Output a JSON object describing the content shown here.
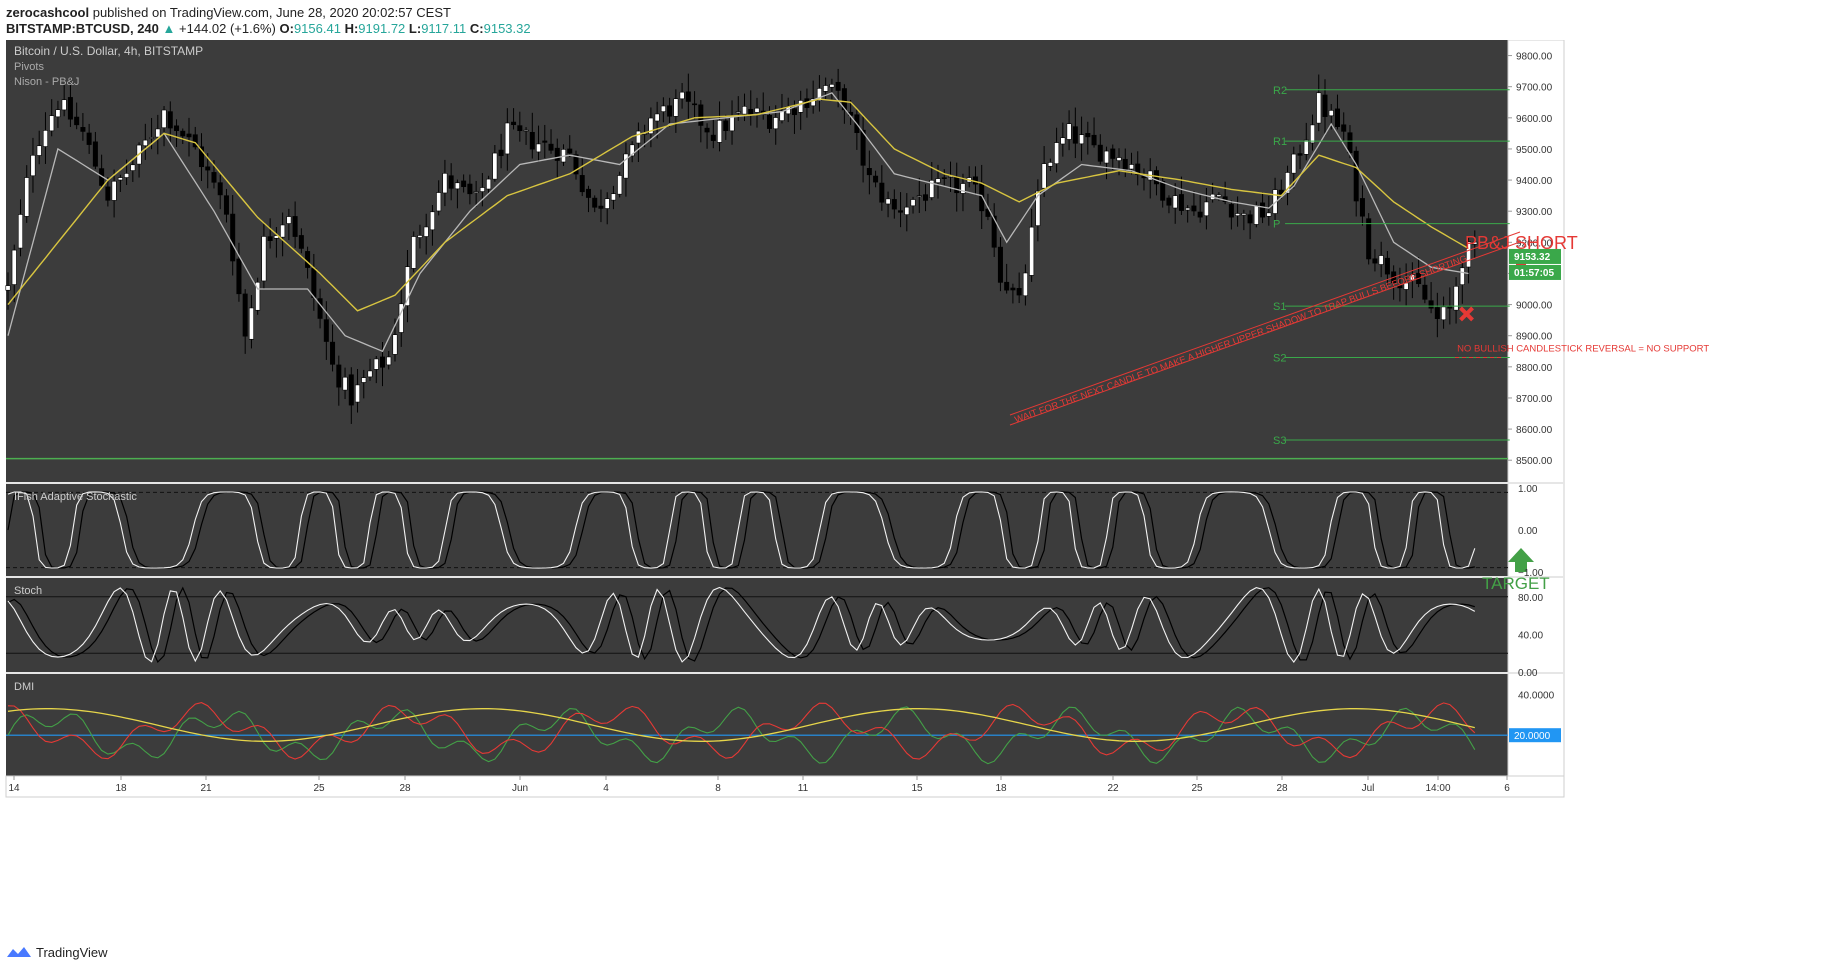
{
  "header": {
    "author": "zerocashcool",
    "published": "published on TradingView.com, June 28, 2020 20:02:57 CEST",
    "symbol": "BITSTAMP:BTCUSD, 240",
    "change": "+144.02 (+1.6%)",
    "o_label": "O:",
    "o": "9156.41",
    "h_label": "H:",
    "h": "9191.72",
    "l_label": "L:",
    "l": "9117.11",
    "c_label": "C:",
    "c": "9153.32"
  },
  "footer": {
    "brand": "TradingView"
  },
  "colors": {
    "panel_bg": "#3c3c3c",
    "ema_slow": "#d8c540",
    "ema_fast": "#b8b8b8",
    "pivot": "#3aa84a",
    "annotation_red": "#e53935",
    "target_green": "#43a047",
    "dmi_plus": "#43a047",
    "dmi_minus": "#e53935",
    "adx": "#e6d54a",
    "dmi_threshold": "#2196f3",
    "price_tag": "#3aa84a"
  },
  "chart_data": [
    {
      "type": "candlestick",
      "title": "Bitcoin / U.S. Dollar, 4h, BITSTAMP",
      "indicators": [
        "Pivots",
        "Nison - PB&J"
      ],
      "ylim": [
        8430,
        9850
      ],
      "y_ticks": [
        9800,
        9700,
        9600,
        9500,
        9400,
        9300,
        9200,
        9100,
        9000,
        8900,
        8800,
        8700,
        8600,
        8500
      ],
      "y_tick_labels": [
        "9800.00",
        "9700.00",
        "9600.00",
        "9500.00",
        "9400.00",
        "9300.00",
        "9200.00",
        "9100.00",
        "9000.00",
        "8900.00",
        "8800.00",
        "8700.00",
        "8600.00",
        "8500.00"
      ],
      "x_ticks": [
        "14",
        "18",
        "21",
        "25",
        "28",
        "Jun",
        "4",
        "8",
        "11",
        "15",
        "18",
        "22",
        "25",
        "28",
        "Jul",
        "14:00",
        "6"
      ],
      "close_path": [
        [
          0,
          9050
        ],
        [
          4,
          9500
        ],
        [
          8,
          9650
        ],
        [
          12,
          9550
        ],
        [
          16,
          9350
        ],
        [
          20,
          9450
        ],
        [
          25,
          9620
        ],
        [
          30,
          9500
        ],
        [
          35,
          9300
        ],
        [
          38,
          8900
        ],
        [
          41,
          9200
        ],
        [
          45,
          9300
        ],
        [
          48,
          9100
        ],
        [
          52,
          8800
        ],
        [
          55,
          8700
        ],
        [
          58,
          8780
        ],
        [
          61,
          8830
        ],
        [
          65,
          9200
        ],
        [
          70,
          9400
        ],
        [
          75,
          9330
        ],
        [
          80,
          9550
        ],
        [
          85,
          9520
        ],
        [
          90,
          9480
        ],
        [
          94,
          9300
        ],
        [
          98,
          9420
        ],
        [
          103,
          9600
        ],
        [
          108,
          9650
        ],
        [
          113,
          9550
        ],
        [
          118,
          9620
        ],
        [
          122,
          9600
        ],
        [
          127,
          9650
        ],
        [
          131,
          9700
        ],
        [
          134,
          9650
        ],
        [
          138,
          9400
        ],
        [
          142,
          9300
        ],
        [
          146,
          9350
        ],
        [
          150,
          9380
        ],
        [
          154,
          9380
        ],
        [
          157,
          9300
        ],
        [
          159,
          9100
        ],
        [
          162,
          9000
        ],
        [
          166,
          9450
        ],
        [
          170,
          9550
        ],
        [
          174,
          9500
        ],
        [
          178,
          9480
        ],
        [
          182,
          9420
        ],
        [
          186,
          9350
        ],
        [
          190,
          9300
        ],
        [
          194,
          9350
        ],
        [
          198,
          9280
        ],
        [
          202,
          9300
        ],
        [
          206,
          9450
        ],
        [
          210,
          9650
        ],
        [
          214,
          9550
        ],
        [
          218,
          9180
        ],
        [
          222,
          9100
        ],
        [
          226,
          9050
        ],
        [
          229,
          8950
        ],
        [
          231,
          8980
        ],
        [
          233,
          9150
        ],
        [
          234,
          9170
        ]
      ],
      "ema_fast_path": [
        [
          0,
          8900
        ],
        [
          8,
          9500
        ],
        [
          16,
          9400
        ],
        [
          25,
          9550
        ],
        [
          33,
          9300
        ],
        [
          40,
          9050
        ],
        [
          48,
          9050
        ],
        [
          54,
          8900
        ],
        [
          60,
          8850
        ],
        [
          66,
          9100
        ],
        [
          74,
          9300
        ],
        [
          82,
          9450
        ],
        [
          90,
          9480
        ],
        [
          98,
          9450
        ],
        [
          106,
          9580
        ],
        [
          115,
          9600
        ],
        [
          124,
          9620
        ],
        [
          132,
          9680
        ],
        [
          136,
          9580
        ],
        [
          142,
          9420
        ],
        [
          150,
          9380
        ],
        [
          156,
          9350
        ],
        [
          160,
          9200
        ],
        [
          165,
          9350
        ],
        [
          172,
          9450
        ],
        [
          180,
          9430
        ],
        [
          188,
          9370
        ],
        [
          196,
          9330
        ],
        [
          202,
          9310
        ],
        [
          206,
          9380
        ],
        [
          212,
          9580
        ],
        [
          216,
          9450
        ],
        [
          222,
          9200
        ],
        [
          228,
          9120
        ],
        [
          234,
          9100
        ]
      ],
      "ema_slow_path": [
        [
          0,
          9000
        ],
        [
          8,
          9200
        ],
        [
          16,
          9400
        ],
        [
          25,
          9550
        ],
        [
          30,
          9520
        ],
        [
          40,
          9280
        ],
        [
          50,
          9100
        ],
        [
          56,
          8980
        ],
        [
          62,
          9030
        ],
        [
          70,
          9200
        ],
        [
          80,
          9350
        ],
        [
          90,
          9420
        ],
        [
          100,
          9540
        ],
        [
          110,
          9600
        ],
        [
          120,
          9610
        ],
        [
          130,
          9660
        ],
        [
          135,
          9650
        ],
        [
          142,
          9500
        ],
        [
          150,
          9420
        ],
        [
          156,
          9390
        ],
        [
          162,
          9330
        ],
        [
          168,
          9390
        ],
        [
          178,
          9430
        ],
        [
          188,
          9400
        ],
        [
          196,
          9370
        ],
        [
          204,
          9350
        ],
        [
          210,
          9480
        ],
        [
          216,
          9440
        ],
        [
          222,
          9330
        ],
        [
          228,
          9250
        ],
        [
          234,
          9180
        ]
      ],
      "pivots": [
        {
          "label": "R2",
          "value": 9690
        },
        {
          "label": "R1",
          "value": 9525
        },
        {
          "label": "P",
          "value": 9260
        },
        {
          "label": "S1",
          "value": 8995
        },
        {
          "label": "S2",
          "value": 8830
        },
        {
          "label": "S3",
          "value": 8565
        }
      ],
      "pivot_start_x": 203,
      "pivot_end_x": 239,
      "target_level": 8505,
      "last_price_label": "9153.32",
      "countdown_label": "01:57:05",
      "annotations": {
        "short": "PB&J SHORT",
        "target": "TARGET",
        "diagonal": "WAIT FOR THE NEXT CANDLE TO MAKE A HIGHER UPPER SHADOW TO TRAP BULLS BEFORE SHORTING",
        "no_support": "NO BULLISH CANDLESTICK REVERSAL = NO SUPPORT"
      }
    },
    {
      "type": "line",
      "title": "IFish Adaptive Stochastic",
      "ylim": [
        -1.1,
        1.1
      ],
      "y_ticks": [
        1,
        0,
        -1
      ],
      "y_tick_labels": [
        "1.00",
        "0.00",
        "−1.00"
      ],
      "levels": [
        0.9,
        -0.9
      ]
    },
    {
      "type": "line",
      "title": "Stoch",
      "ylim": [
        0,
        100
      ],
      "y_ticks": [
        80,
        40,
        0
      ],
      "y_tick_labels": [
        "80.00",
        "40.00",
        "0.00"
      ],
      "levels": [
        80,
        20
      ]
    },
    {
      "type": "line",
      "title": "DMI",
      "ylim": [
        0,
        50
      ],
      "y_ticks": [
        40
      ],
      "y_tick_labels": [
        "40.0000"
      ],
      "threshold": 20,
      "threshold_label": "20.0000"
    }
  ]
}
